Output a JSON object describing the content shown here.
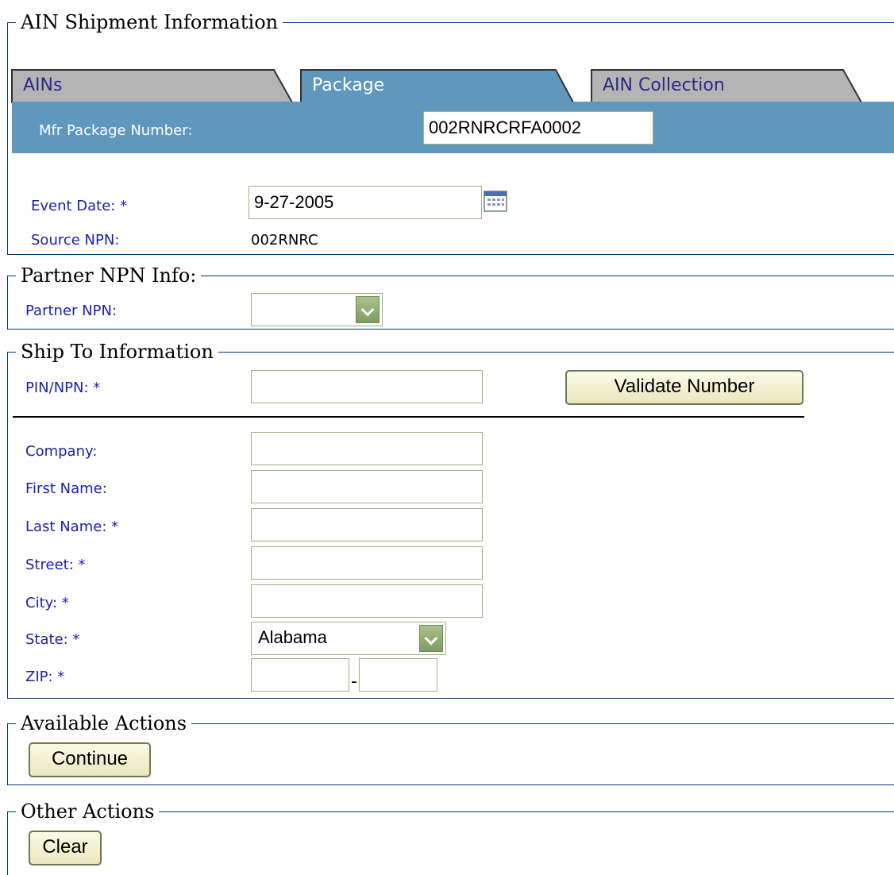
{
  "shipment": {
    "legend": "AIN Shipment Information",
    "tabs": [
      {
        "label": "AINs"
      },
      {
        "label": "Package"
      },
      {
        "label": "AIN Collection"
      }
    ],
    "mfr_label": "Mfr Package Number:",
    "mfr_value": "002RNRCRFA0002",
    "event_date_label": "Event Date: *",
    "event_date_value": "9-27-2005",
    "source_npn_label": "Source NPN:",
    "source_npn_value": "002RNRC"
  },
  "partner": {
    "legend": "Partner NPN Info:",
    "npn_label": "Partner NPN:",
    "npn_value": ""
  },
  "ship_to": {
    "legend": "Ship To Information",
    "pin_label": "PIN/NPN: *",
    "validate_button": "Validate Number",
    "company_label": "Company:",
    "first_name_label": "First Name:",
    "last_name_label": "Last Name: *",
    "street_label": "Street: *",
    "city_label": "City: *",
    "state_label": "State: *",
    "state_value": "Alabama",
    "zip_label": "ZIP: *",
    "zip_separator": "-"
  },
  "available_actions": {
    "legend": "Available Actions",
    "continue_button": "Continue"
  },
  "other_actions": {
    "legend": "Other Actions",
    "clear_button": "Clear"
  },
  "colors": {
    "tab_active": "#5f98bc",
    "tab_inactive": "#b4b4b4",
    "label_blue": "#1e1eaa",
    "border_navy": "#003a70"
  },
  "icons": {
    "calendar": "calendar-icon",
    "dropdown": "chevron-down-icon"
  }
}
